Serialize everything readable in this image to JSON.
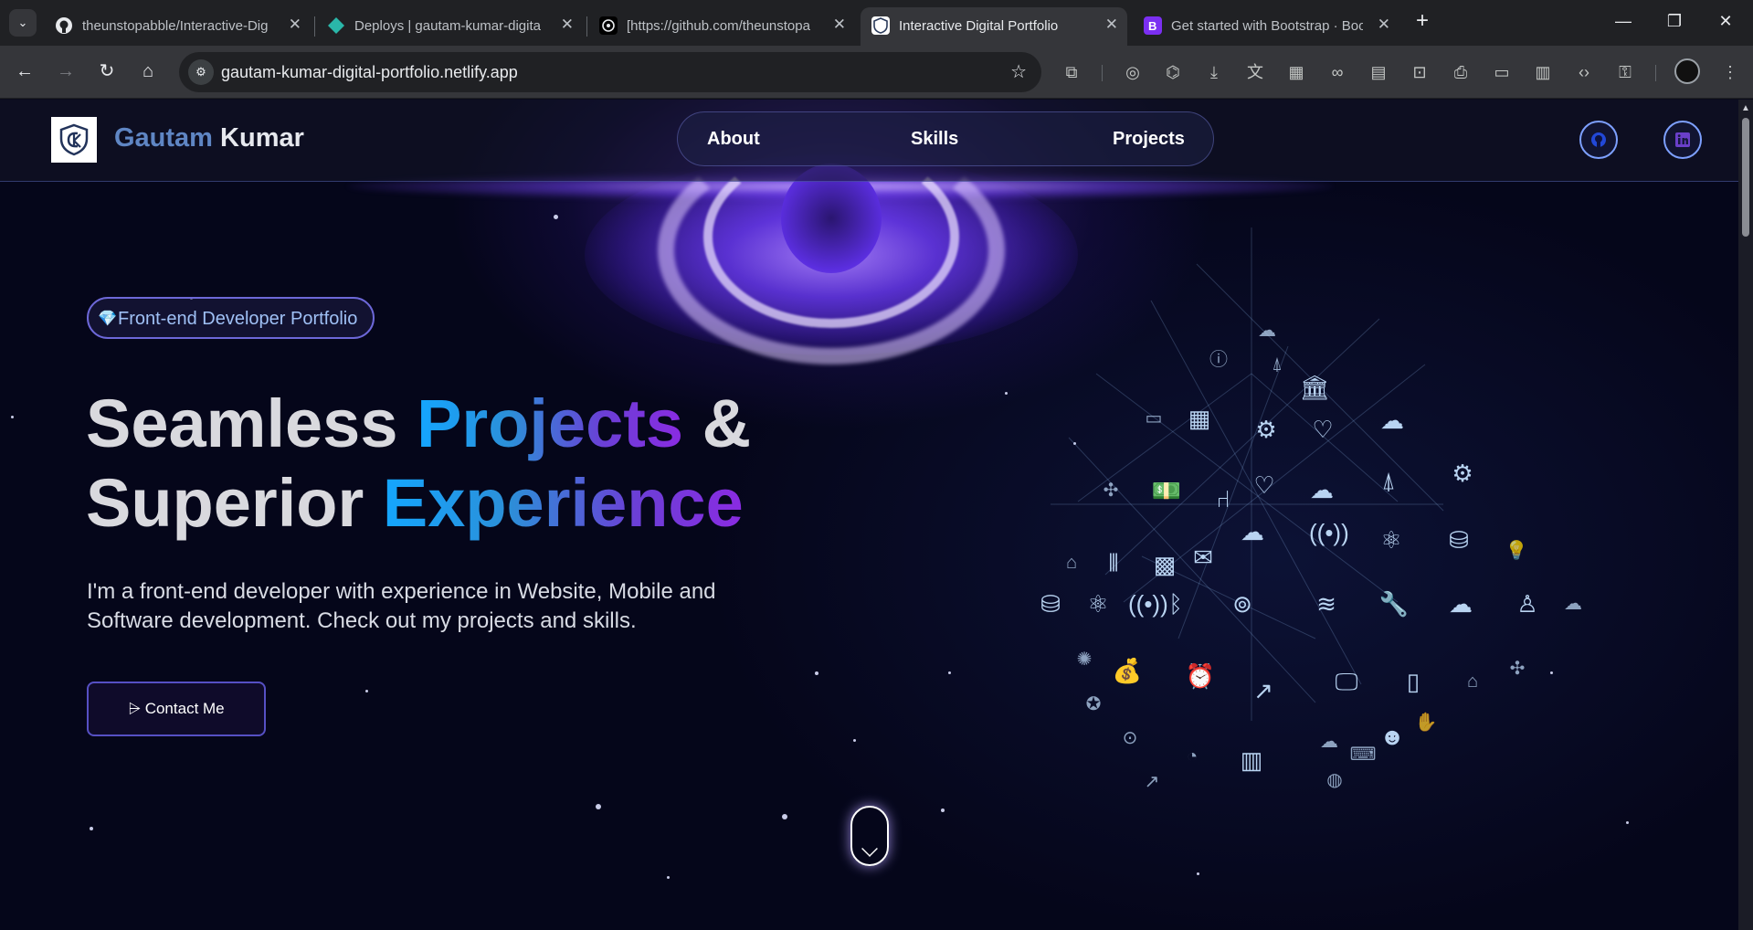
{
  "browser": {
    "tabs": [
      {
        "title": "theunstopabble/Interactive-Dig",
        "icon": "github-icon",
        "active": false
      },
      {
        "title": "Deploys | gautam-kumar-digita",
        "icon": "netlify-icon",
        "active": false
      },
      {
        "title": "[https://github.com/theunstopa",
        "icon": "chatgpt-icon",
        "active": false
      },
      {
        "title": "Interactive Digital Portfolio",
        "icon": "portfolio-logo-icon",
        "active": true
      },
      {
        "title": "Get started with Bootstrap · Boo",
        "icon": "bootstrap-icon",
        "active": false
      }
    ],
    "url": "gautam-kumar-digital-portfolio.netlify.app"
  },
  "site": {
    "brand_first": "Gautam",
    "brand_last": "Kumar",
    "nav": [
      "About",
      "Skills",
      "Projects"
    ],
    "badge": "Front-end Developer Portfolio",
    "headline": {
      "line1_plain": "Seamless ",
      "line1_grad": "Projects",
      "line1_end": " &",
      "line2_plain": "Superior ",
      "line2_grad": "Experience"
    },
    "intro": "I'm a front-end developer with experience in Website, Mobile and Software development. Check out my projects and skills.",
    "contact_button": "Contact Me"
  },
  "colors": {
    "accent_gradient_start": "#14a6ff",
    "accent_gradient_end": "#8a2be2",
    "background": "#05061a",
    "nav_border": "#7da0ff"
  }
}
